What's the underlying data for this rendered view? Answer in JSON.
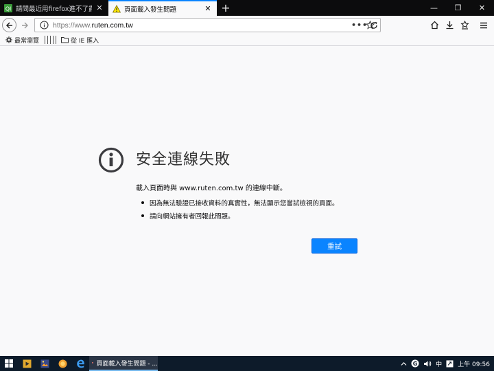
{
  "tabs": [
    {
      "title": "請問最近用firefox進不了露天拍",
      "close": "✕",
      "active": false,
      "favicon": "site-favicon"
    },
    {
      "title": "頁面載入發生問題",
      "close": "✕",
      "active": true,
      "favicon": "warning-icon"
    }
  ],
  "new_tab": "+",
  "window_controls": {
    "minimize": "—",
    "maximize": "❐",
    "close": "✕"
  },
  "navbar": {
    "url_prefix": "https://www.",
    "url_host": "ruten.com.tw",
    "page_actions": "•••"
  },
  "bookmarks": {
    "most_visited": "最常瀏覽",
    "ie_import": "從 IE 匯入"
  },
  "error": {
    "title": "安全連線失敗",
    "description": "載入頁面時與 www.ruten.com.tw 的連線中斷。",
    "items": [
      "因為無法驗證已接收資料的真實性，無法顯示您嘗試檢視的頁面。",
      "請向網站擁有者回報此問題。"
    ],
    "retry_label": "重試"
  },
  "taskbar": {
    "active_app_label": "頁面載入發生問題 - ...",
    "ime_label": "中",
    "clock": "上午 09:56"
  },
  "colors": {
    "accent": "#0a84ff",
    "tabbar": "#0c0c0d",
    "taskbar": "#0d1b2a"
  }
}
